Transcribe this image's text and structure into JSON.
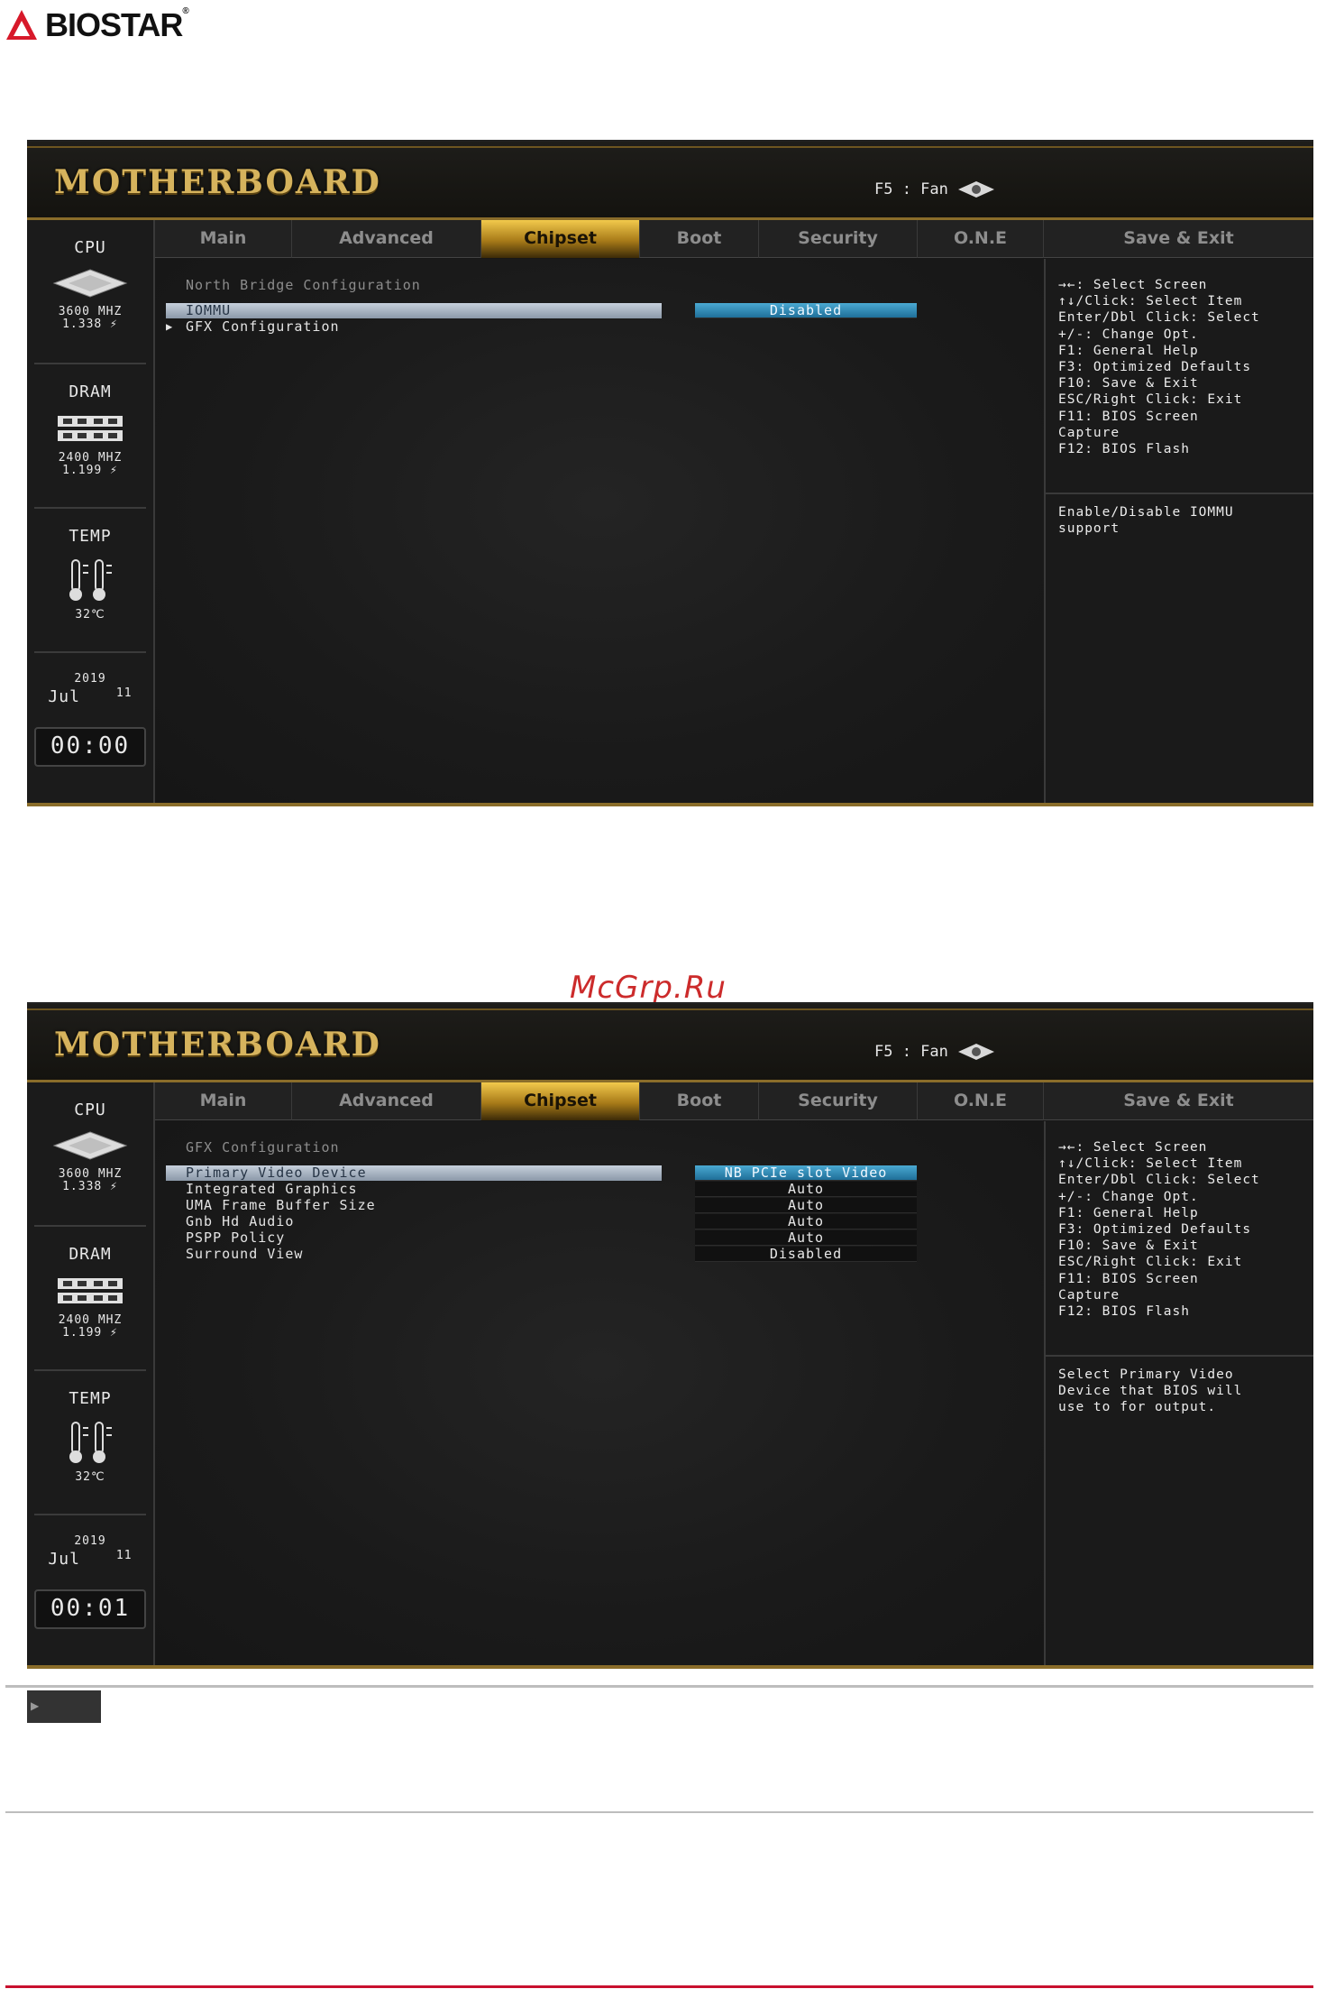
{
  "brand": {
    "name": "BIOSTAR",
    "reg": "®",
    "icon": "biostar-logo-icon"
  },
  "watermark": "McGrp.Ru",
  "screens": [
    {
      "title": "MOTHERBOARD",
      "fan_label": "F5 : Fan",
      "tabs": [
        "Main",
        "Advanced",
        "Chipset",
        "Boot",
        "Security",
        "O.N.E",
        "Save & Exit"
      ],
      "active_tab": "Chipset",
      "sidebar": {
        "cpu_label": "CPU",
        "cpu_freq": "3600 MHZ",
        "cpu_volt": "1.338 ⚡",
        "dram_label": "DRAM",
        "dram_freq": "2400 MHZ",
        "dram_volt": "1.199 ⚡",
        "temp_label": "TEMP",
        "temp_value": "32℃",
        "year": "2019",
        "month": "Jul",
        "day": "11",
        "time": "00:00"
      },
      "section_title": "North Bridge Configuration",
      "items": [
        {
          "label": "IOMMU",
          "value": "Disabled",
          "selected": true,
          "submenu": false
        },
        {
          "label": "GFX Configuration",
          "value": "",
          "selected": false,
          "submenu": true
        }
      ],
      "help": "→←: Select Screen\n↑↓/Click: Select Item\nEnter/Dbl Click: Select\n+/-: Change Opt.\nF1: General Help\nF3: Optimized Defaults\nF10: Save & Exit\nESC/Right Click: Exit\nF11: BIOS Screen\nCapture\nF12: BIOS Flash",
      "description": "Enable/Disable IOMMU\nsupport"
    },
    {
      "title": "MOTHERBOARD",
      "fan_label": "F5 : Fan",
      "tabs": [
        "Main",
        "Advanced",
        "Chipset",
        "Boot",
        "Security",
        "O.N.E",
        "Save & Exit"
      ],
      "active_tab": "Chipset",
      "sidebar": {
        "cpu_label": "CPU",
        "cpu_freq": "3600 MHZ",
        "cpu_volt": "1.338 ⚡",
        "dram_label": "DRAM",
        "dram_freq": "2400 MHZ",
        "dram_volt": "1.199 ⚡",
        "temp_label": "TEMP",
        "temp_value": "32℃",
        "year": "2019",
        "month": "Jul",
        "day": "11",
        "time": "00:01"
      },
      "section_title": "GFX Configuration",
      "items": [
        {
          "label": "Primary Video Device",
          "value": "NB PCIe slot Video",
          "selected": true,
          "submenu": false
        },
        {
          "label": "Integrated Graphics",
          "value": "Auto",
          "selected": false,
          "submenu": false
        },
        {
          "label": "UMA Frame Buffer Size",
          "value": "Auto",
          "selected": false,
          "submenu": false
        },
        {
          "label": "Gnb Hd Audio",
          "value": "Auto",
          "selected": false,
          "submenu": false
        },
        {
          "label": "PSPP Policy",
          "value": "Auto",
          "selected": false,
          "submenu": false
        },
        {
          "label": "Surround View",
          "value": "Disabled",
          "selected": false,
          "submenu": false
        }
      ],
      "help": "→←: Select Screen\n↑↓/Click: Select Item\nEnter/Dbl Click: Select\n+/-: Change Opt.\nF1: General Help\nF3: Optimized Defaults\nF10: Save & Exit\nESC/Right Click: Exit\nF11: BIOS Screen\nCapture\nF12: BIOS Flash",
      "description": "Select Primary Video\nDevice that BIOS will\nuse to for output."
    }
  ],
  "colors": {
    "accent_gold": "#d6b35d",
    "selected_item": "#9aa7b6",
    "selected_value": "#2f8fc0",
    "brand_red": "#c8102e",
    "watermark_red": "#cc2b2b"
  }
}
